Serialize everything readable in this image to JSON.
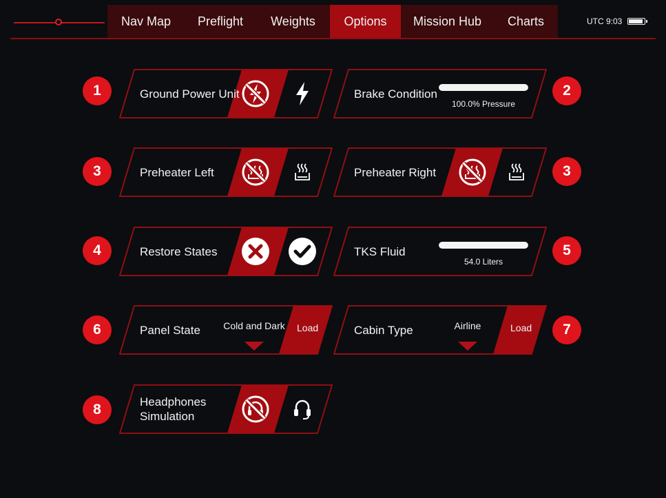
{
  "topbar": {
    "slider_level": 0.5,
    "tabs": [
      {
        "label": "Nav Map",
        "active": false
      },
      {
        "label": "Preflight",
        "active": false
      },
      {
        "label": "Weights",
        "active": false
      },
      {
        "label": "Options",
        "active": true
      },
      {
        "label": "Mission Hub",
        "active": false
      },
      {
        "label": "Charts",
        "active": false
      }
    ],
    "utc_label": "UTC 9:03",
    "battery_level": 0.9
  },
  "options": {
    "ground_power": {
      "badge": "1",
      "label": "Ground Power Unit",
      "off_icon": "no-power-icon",
      "on_icon": "lightning-icon"
    },
    "brake": {
      "badge": "2",
      "label": "Brake Condition",
      "level": 1.0,
      "value_text": "100.0% Pressure"
    },
    "preheater_left": {
      "badge": "3",
      "label": "Preheater Left",
      "off_icon": "no-heat-icon",
      "on_icon": "heat-icon"
    },
    "preheater_right": {
      "badge": "3",
      "label": "Preheater Right",
      "off_icon": "no-heat-icon",
      "on_icon": "heat-icon"
    },
    "restore_states": {
      "badge": "4",
      "label": "Restore States",
      "off_icon": "x-circle-icon",
      "on_icon": "check-circle-icon"
    },
    "tks_fluid": {
      "badge": "5",
      "label": "TKS Fluid",
      "level": 1.0,
      "value_text": "54.0 Liters"
    },
    "panel_state": {
      "badge": "6",
      "label": "Panel State",
      "selected": "Cold and Dark",
      "load_label": "Load"
    },
    "cabin_type": {
      "badge": "7",
      "label": "Cabin Type",
      "selected": "Airline",
      "load_label": "Load"
    },
    "headphones": {
      "badge": "8",
      "label": "Headphones Simulation",
      "off_icon": "no-headset-icon",
      "on_icon": "headset-icon"
    }
  },
  "colors": {
    "accent": "#a40c12",
    "badge": "#e0141c",
    "background": "#0b0d10",
    "nav_bg": "#3a0a0c"
  }
}
